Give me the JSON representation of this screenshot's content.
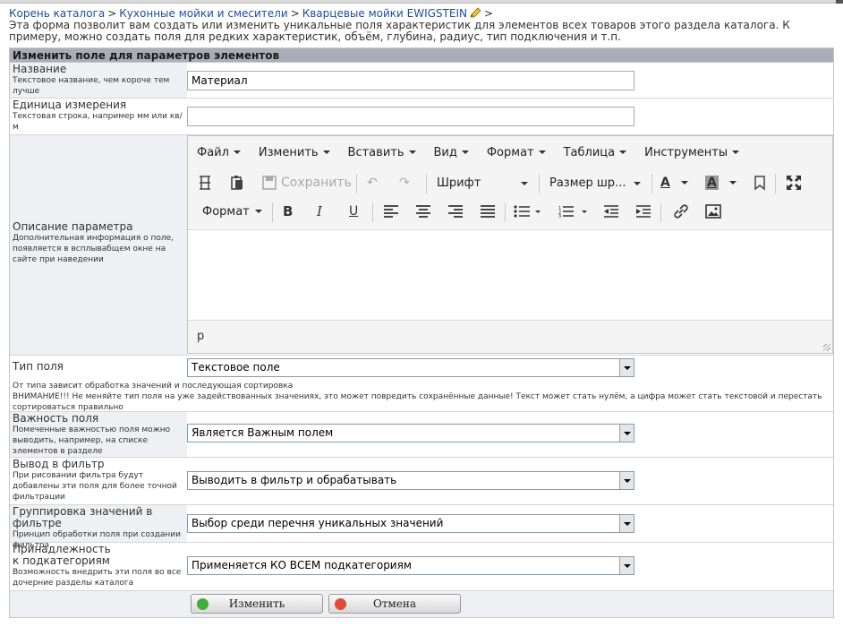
{
  "breadcrumb": {
    "items": [
      "Корень каталога",
      "Кухонные мойки и смесители",
      "Кварцевые мойки EWIGSTEIN"
    ],
    "separator": ">"
  },
  "intro": "Эта форма позволит вам создать или изменить уникальные поля характеристик для элементов всех товаров этого раздела каталога. К примеру, можно создать поля для редких характеристик, объём, глубина, радиус, тип подключения и т.п.",
  "form": {
    "header": "Изменить поле для параметров элементов",
    "name": {
      "label": "Название",
      "desc": "Текстовое название, чем короче тем лучше",
      "value": "Материал"
    },
    "unit": {
      "label": "Единица измерения",
      "desc": "Текстовая строка, например мм или кв/м",
      "value": ""
    },
    "description": {
      "label": "Описание параметра",
      "desc": "Дополнительная информация о поле, появляется в всплывабщем окне на сайте при наведении"
    },
    "field_type": {
      "label": "Тип поля",
      "value": "Текстовое поле",
      "note1": "От типа зависит обработка значений и последующая сортировка",
      "note2": "ВНИМАНИЕ!!! Не меняйте тип поля на уже задействованных значениях, это может повредить сохранённые данные! Текст может стать нулём, а цифра может стать текстовой и перестать сортироваться правильно"
    },
    "importance": {
      "label": "Важность поля",
      "desc": "Помеченные важностью поля можно выводить, например, на списке элементов в разделе",
      "value": "Является Важным полем"
    },
    "filter_output": {
      "label": "Вывод в фильтр",
      "desc": "При рисовании фильтра будут добавлены эти поля для более точной фильтрации",
      "value": "Выводить в фильтр и обрабатывать"
    },
    "filter_grouping": {
      "label": "Группировка значений в фильтре",
      "desc": "Принцип обработки поля при создании фильтра",
      "value": "Выбор среди перечня уникальных значений"
    },
    "subcategories": {
      "label": "Принадлежность к подкатегориям",
      "desc": "Возможность внедрить эти поля во все дочерние разделы каталога",
      "value": "Применяется КО ВСЕМ подкатегориям"
    },
    "buttons": {
      "submit": "Изменить",
      "cancel": "Отмена"
    }
  },
  "editor": {
    "menu": [
      "Файл",
      "Изменить",
      "Вставить",
      "Вид",
      "Формат",
      "Таблица",
      "Инструменты"
    ],
    "save_label": "Сохранить",
    "font_label": "Шрифт",
    "size_label": "Размер шр...",
    "format_label": "Формат",
    "status_path": "p"
  },
  "colors": {
    "link": "#1d4d9a",
    "header_bg": "#a9aeb6",
    "alt_row": "#eef0f3",
    "ok_icon": "#3fae3a",
    "cancel_icon": "#e04a3a"
  }
}
